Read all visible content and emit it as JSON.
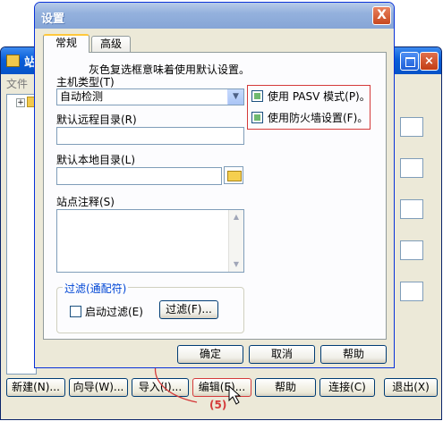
{
  "background_window": {
    "title": "站",
    "menu_first": "文件",
    "buttons": {
      "new": "新建(N)...",
      "wizard": "向导(W)...",
      "import": "导入(I)...",
      "edit": "编辑(E)...",
      "help": "帮助",
      "connect": "连接(C)",
      "exit": "退出(X)"
    }
  },
  "dialog": {
    "title": "设置",
    "close_glyph": "X",
    "tabs": [
      "常规",
      "高级"
    ],
    "hint": "灰色复选框意味着使用默认设置。",
    "host_type_label": "主机类型(T)",
    "host_type_value": "自动检测",
    "pasv_label": "使用 PASV 模式(P)。",
    "firewall_label": "使用防火墙设置(F)。",
    "remote_dir_label": "默认远程目录(R)",
    "remote_dir_value": "",
    "local_dir_label": "默认本地目录(L)",
    "local_dir_value": "",
    "notes_label": "站点注释(S)",
    "notes_value": "",
    "filter_group": "过滤(通配符)",
    "enable_filter_label": "启动过滤(E)",
    "filter_button": "过滤(F)...",
    "ok": "确定",
    "cancel": "取消",
    "help": "帮助"
  },
  "annotation": {
    "step": "(5)"
  },
  "colors": {
    "highlight_frame": "#d43a3a",
    "checkbox_grey": "#6fb96f",
    "xp_blue": "#0a5ed7"
  }
}
